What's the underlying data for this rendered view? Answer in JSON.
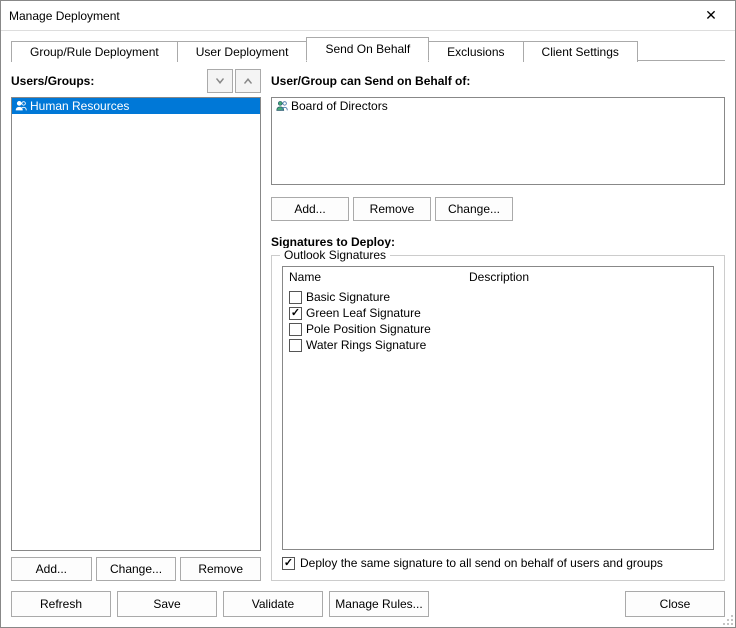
{
  "window": {
    "title": "Manage Deployment"
  },
  "tabs": [
    {
      "label": "Group/Rule Deployment",
      "active": false
    },
    {
      "label": "User Deployment",
      "active": false
    },
    {
      "label": "Send On Behalf",
      "active": true
    },
    {
      "label": "Exclusions",
      "active": false
    },
    {
      "label": "Client Settings",
      "active": false
    }
  ],
  "left": {
    "header": "Users/Groups:",
    "items": [
      {
        "label": "Human Resources",
        "selected": true
      }
    ],
    "buttons": {
      "add": "Add...",
      "change": "Change...",
      "remove": "Remove"
    }
  },
  "right": {
    "behalf_header": "User/Group can Send on Behalf of:",
    "behalf_items": [
      {
        "label": "Board of Directors"
      }
    ],
    "behalf_buttons": {
      "add": "Add...",
      "remove": "Remove",
      "change": "Change..."
    },
    "signatures_header": "Signatures to Deploy:",
    "fieldset_label": "Outlook Signatures",
    "columns": {
      "name": "Name",
      "description": "Description"
    },
    "signatures": [
      {
        "name": "Basic Signature",
        "checked": false
      },
      {
        "name": "Green Leaf Signature",
        "checked": true
      },
      {
        "name": "Pole Position Signature",
        "checked": false
      },
      {
        "name": "Water Rings Signature",
        "checked": false
      }
    ],
    "deploy_all_checked": true,
    "deploy_all_label": "Deploy the same signature to all send on behalf of users and groups"
  },
  "bottom": {
    "refresh": "Refresh",
    "save": "Save",
    "validate": "Validate",
    "manage_rules": "Manage Rules...",
    "close": "Close"
  }
}
